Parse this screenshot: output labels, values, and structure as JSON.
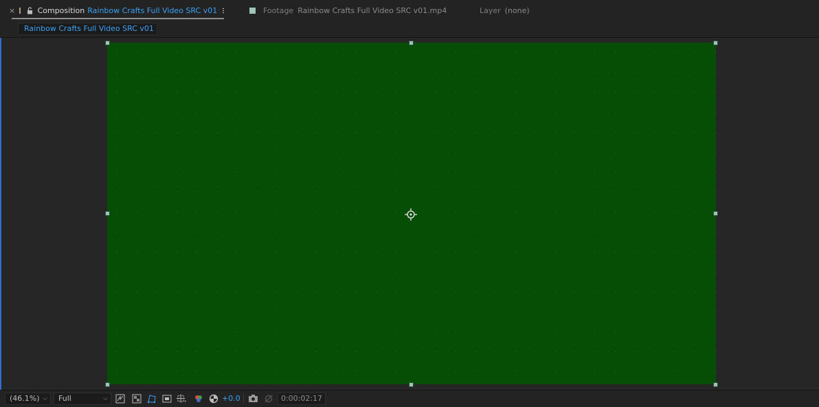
{
  "tabs": {
    "composition": {
      "close": "×",
      "prefix": "Composition",
      "name": "Rainbow Crafts Full Video SRC v01",
      "swatch_color": "#b89a7d"
    },
    "footage": {
      "prefix": "Footage",
      "name": "Rainbow Crafts Full Video SRC v01.mp4",
      "swatch_color": "#9ec5b5"
    },
    "layer": {
      "prefix": "Layer",
      "name": "(none)"
    }
  },
  "breadcrumb": {
    "comp": "Rainbow Crafts Full Video SRC v01"
  },
  "viewer": {
    "background_color": "#064d06",
    "handle_color": "#9ec5b5"
  },
  "toolbar": {
    "zoom": "(46.1%)",
    "resolution": "Full",
    "exposure": "+0.0",
    "timecode": "0:00:02:17",
    "icons": [
      "toggle-alpha-icon",
      "transparency-grid-icon",
      "mask-path-icon",
      "region-of-interest-icon",
      "grid-guides-icon",
      "channel-rgb-icon",
      "reset-exposure-icon",
      "snapshot-camera-icon",
      "show-snapshot-icon"
    ]
  }
}
